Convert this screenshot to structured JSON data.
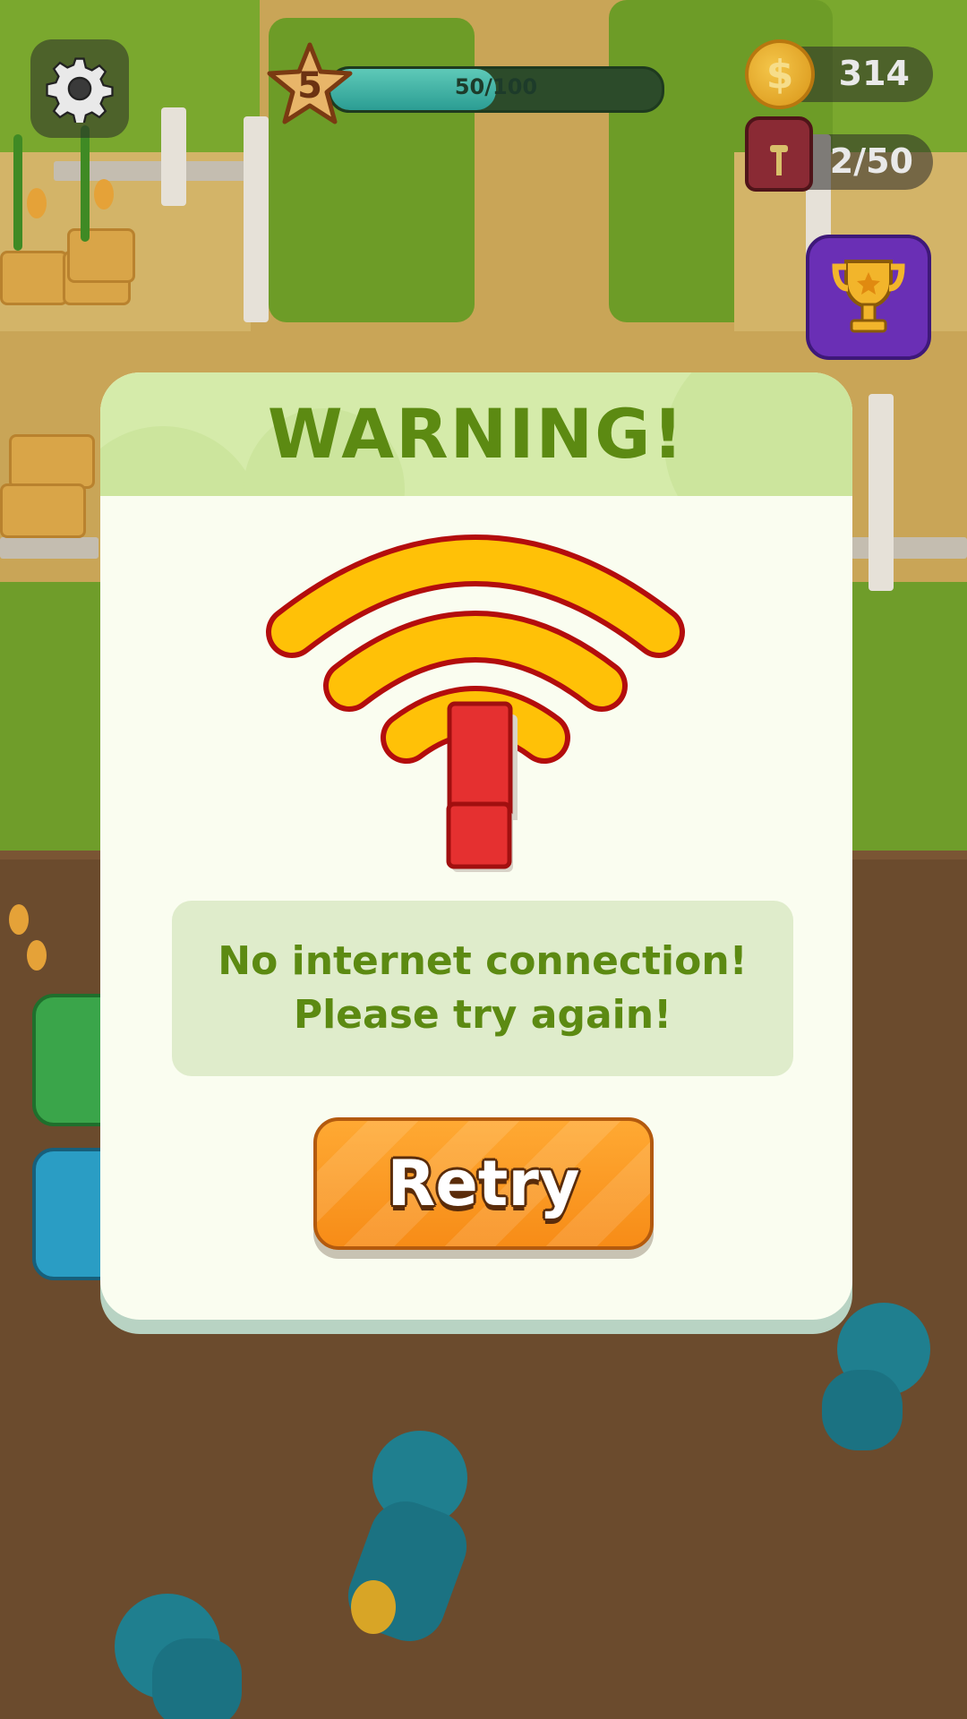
{
  "hud": {
    "level": "5",
    "progress_text": "50/100",
    "progress_fraction": 0.5,
    "coins": "314",
    "bag": "2/50",
    "icons": {
      "settings": "gear-icon",
      "coin": "coin-icon",
      "coin_symbol": "$",
      "bag": "backpack-icon",
      "trophy": "trophy-icon"
    }
  },
  "dialog": {
    "title": "WARNING!",
    "icon": "no-wifi-warning-icon",
    "message_line1": "No internet connection!",
    "message_line2": "Please try again!",
    "retry_label": "Retry"
  },
  "colors": {
    "title": "#5c8a12",
    "retry": "#f78c17",
    "wifi_arc": "#ffc107",
    "exclamation": "#e53030",
    "trophy_btn": "#6a2fb5"
  }
}
